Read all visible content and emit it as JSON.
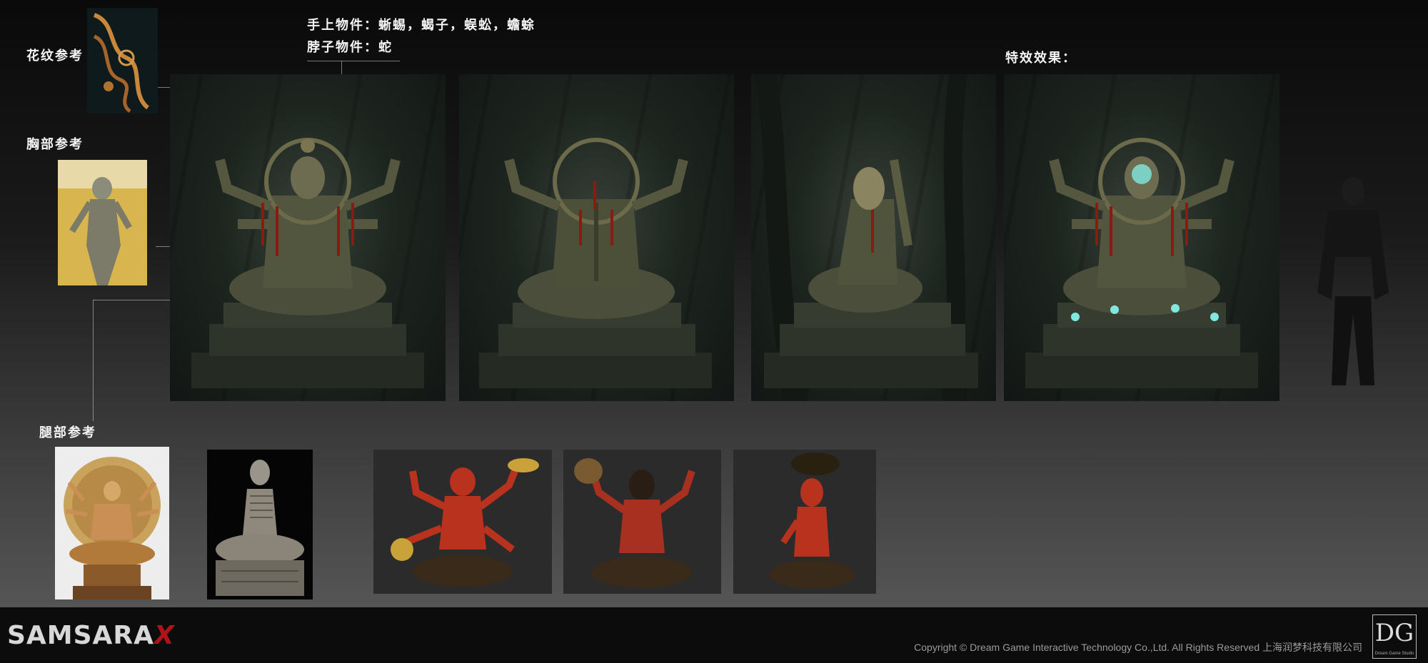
{
  "labels": {
    "pattern_ref": "花纹参考",
    "chest_ref": "胸部参考",
    "leg_ref": "腿部参考",
    "hand_items": "手上物件：蜥蜴，蝎子，蜈蚣，蟾蜍",
    "neck_items": "脖子物件：蛇",
    "vfx": "特效效果："
  },
  "footer": {
    "logo_main": "SAMSARA",
    "logo_x": "X",
    "copyright": "Copyright © Dream Game Interactive Technology Co.,Ltd. All Rights Reserved 上海润梦科技有限公司",
    "dg_mark": "DG",
    "dg_sub": "Dream Game Studio"
  },
  "colors": {
    "statue_bronze": "#5a5a3e",
    "blood_red": "#8a1a12",
    "vfx_cyan": "#7fe8e0",
    "red_statue": "#b8321e",
    "gold": "#c9a23a"
  }
}
